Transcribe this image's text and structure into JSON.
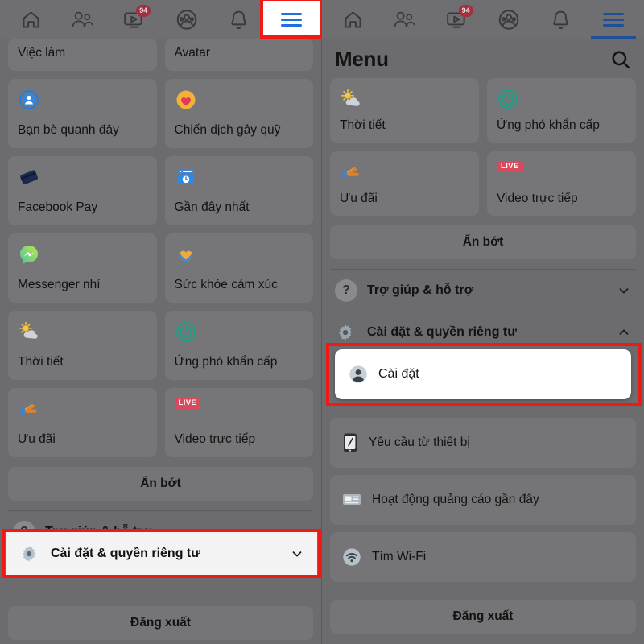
{
  "nav": {
    "items": [
      {
        "name": "home",
        "label": "Trang chủ",
        "badge": null
      },
      {
        "name": "friends",
        "label": "Bạn bè",
        "badge": null
      },
      {
        "name": "video",
        "label": "Video",
        "badge": "94"
      },
      {
        "name": "groups",
        "label": "Nhóm",
        "badge": null
      },
      {
        "name": "notifications",
        "label": "Thông báo",
        "badge": null
      },
      {
        "name": "menu",
        "label": "Menu",
        "badge": null
      }
    ],
    "badge_count": "94",
    "active_tab": "menu"
  },
  "left": {
    "tiles": [
      {
        "label": "Việc làm",
        "icon": "briefcase-icon"
      },
      {
        "label": "Avatar",
        "icon": "avatar-icon"
      },
      {
        "label": "Bạn bè quanh đây",
        "icon": "nearby-friends-icon"
      },
      {
        "label": "Chiến dịch gây quỹ",
        "icon": "fundraiser-heart-icon"
      },
      {
        "label": "Facebook Pay",
        "icon": "facebook-pay-icon"
      },
      {
        "label": "Gần đây nhất",
        "icon": "recent-icon"
      },
      {
        "label": "Messenger nhí",
        "icon": "messenger-kids-icon"
      },
      {
        "label": "Sức khỏe cảm xúc",
        "icon": "emotional-health-icon"
      },
      {
        "label": "Thời tiết",
        "icon": "weather-icon"
      },
      {
        "label": "Ứng phó khẩn cấp",
        "icon": "crisis-response-icon"
      },
      {
        "label": "Ưu đãi",
        "icon": "offers-icon"
      },
      {
        "label": "Video trực tiếp",
        "icon": "live-video-icon",
        "badge": "LIVE"
      }
    ],
    "see_less_label": "Ẩn bớt",
    "rows": [
      {
        "label": "Trợ giúp & hỗ trợ",
        "icon": "help-question-icon",
        "chevron": "down"
      },
      {
        "label": "Cài đặt & quyền riêng tư",
        "icon": "gear-icon",
        "chevron": "down",
        "highlighted": true
      }
    ],
    "logout_label": "Đăng xuất"
  },
  "right": {
    "header_title": "Menu",
    "search_icon": "search-icon",
    "tiles": [
      {
        "label": "Thời tiết",
        "icon": "weather-icon"
      },
      {
        "label": "Ứng phó khẩn cấp",
        "icon": "crisis-response-icon"
      },
      {
        "label": "Ưu đãi",
        "icon": "offers-icon"
      },
      {
        "label": "Video trực tiếp",
        "icon": "live-video-icon",
        "badge": "LIVE"
      }
    ],
    "see_less_label": "Ẩn bớt",
    "rows": [
      {
        "label": "Trợ giúp & hỗ trợ",
        "icon": "help-question-icon",
        "chevron": "down"
      },
      {
        "label": "Cài đặt & quyền riêng tư",
        "icon": "gear-icon",
        "chevron": "up"
      }
    ],
    "subitems": [
      {
        "label": "Cài đặt",
        "icon": "account-circle-icon",
        "highlighted": true
      },
      {
        "label": "Yêu cầu từ thiết bị",
        "icon": "device-request-icon",
        "highlighted": false
      },
      {
        "label": "Hoạt động quảng cáo gần đây",
        "icon": "recent-ad-activity-icon",
        "highlighted": false
      },
      {
        "label": "Tìm Wi-Fi",
        "icon": "wifi-icon",
        "highlighted": false
      }
    ],
    "logout_label": "Đăng xuất"
  },
  "colors": {
    "annotation": "#ef1a15",
    "facebook_blue": "#1f6fe0",
    "badge_red": "#a23040",
    "live_red": "#d94a5e",
    "dim_background": "#6c6c6e",
    "tile_background": "#767678",
    "highlight_white": "#ffffff"
  }
}
